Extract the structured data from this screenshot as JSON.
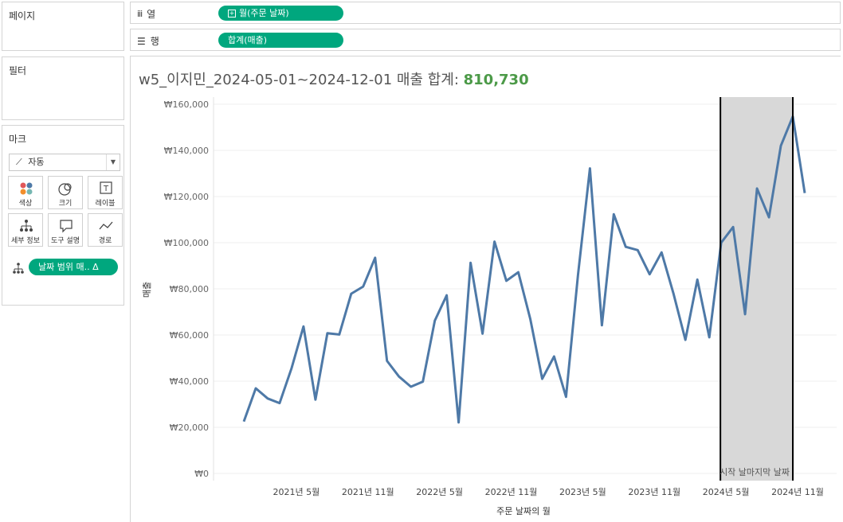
{
  "panels": {
    "pages": "페이지",
    "filters": "필터",
    "marks": "마크"
  },
  "shelves": {
    "columns": {
      "label": "열",
      "pill": "월(주문 날짜)"
    },
    "rows": {
      "label": "행",
      "pill": "합계(매출)"
    }
  },
  "marks": {
    "type": "자동",
    "buttons": [
      "색상",
      "크기",
      "레이블",
      "세부 정보",
      "도구 설명",
      "경로"
    ],
    "detail_pill": "날짜 범위 매.. Δ"
  },
  "viz": {
    "title_prefix": "w5_이지민_2024-05-01~2024-12-01 매출 합계: ",
    "title_total": "810,730",
    "band_label": "시작 날마지막 날짜"
  },
  "chart_data": {
    "type": "line",
    "xlabel": "주문 날짜의 월",
    "ylabel": "매출",
    "ylim": [
      0,
      160000
    ],
    "yticks": [
      "₩0",
      "₩20,000",
      "₩40,000",
      "₩60,000",
      "₩80,000",
      "₩100,000",
      "₩120,000",
      "₩140,000",
      "₩160,000"
    ],
    "xticks": [
      {
        "label": "2021년 5월",
        "x": 4
      },
      {
        "label": "2021년 11월",
        "x": 10
      },
      {
        "label": "2022년 5월",
        "x": 16
      },
      {
        "label": "2022년 11월",
        "x": 22
      },
      {
        "label": "2023년 5월",
        "x": 28
      },
      {
        "label": "2023년 11월",
        "x": 34
      },
      {
        "label": "2024년 5월",
        "x": 40
      },
      {
        "label": "2024년 11월",
        "x": 46
      }
    ],
    "highlight_range": [
      40,
      47
    ],
    "series": [
      {
        "color": "#4e79a7",
        "values": [
          22500,
          36900,
          32500,
          30500,
          45600,
          63700,
          32000,
          60800,
          60200,
          77900,
          81000,
          93500,
          48800,
          42000,
          37600,
          39800,
          66200,
          77200,
          22100,
          91300,
          60600,
          100500,
          83500,
          87200,
          67000,
          41000,
          50700,
          33200,
          86000,
          132200,
          64200,
          112300,
          98200,
          96800,
          86300,
          95800,
          78000,
          57900,
          84000,
          59000,
          100000,
          106800,
          69000,
          123500,
          111000,
          142000,
          154700,
          121500
        ]
      }
    ]
  }
}
